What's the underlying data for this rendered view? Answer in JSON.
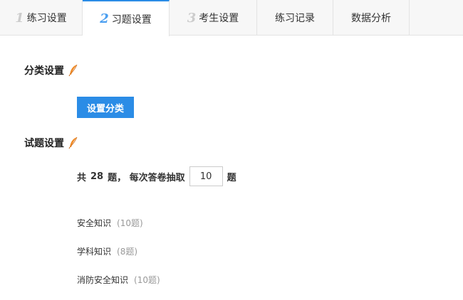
{
  "tabs": [
    {
      "num": "1",
      "label": "练习设置",
      "active": false
    },
    {
      "num": "2",
      "label": "习题设置",
      "active": true
    },
    {
      "num": "3",
      "label": "考生设置",
      "active": false
    },
    {
      "num": "",
      "label": "练习记录",
      "active": false
    },
    {
      "num": "",
      "label": "数据分析",
      "active": false
    }
  ],
  "category_section": {
    "title": "分类设置",
    "button_label": "设置分类"
  },
  "question_section": {
    "title": "试题设置",
    "prefix": "共",
    "total": "28",
    "middle": "题， 每次答卷抽取",
    "per_exam_value": "10",
    "suffix": "题"
  },
  "categories": [
    {
      "name": "安全知识",
      "count": "(10题)"
    },
    {
      "name": "学科知识",
      "count": "(8题)"
    },
    {
      "name": "消防安全知识",
      "count": "(10题)"
    }
  ],
  "colors": {
    "accent": "#2b8ce6",
    "feather": "#f08a24"
  },
  "icons": {
    "section_marker": "feather-icon"
  }
}
